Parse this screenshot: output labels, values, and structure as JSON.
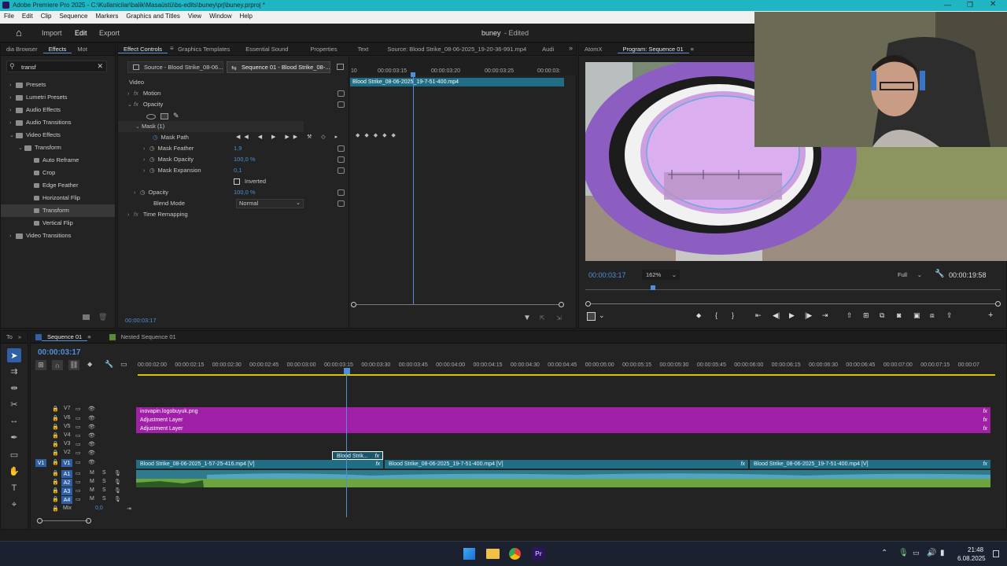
{
  "title_bar": {
    "text": "Adobe Premiere Pro 2025 - C:\\Kullanicilar\\balik\\Masaüstü\\bs-edits\\buney\\prj\\buney.prproj *"
  },
  "menu": [
    "File",
    "Edit",
    "Clip",
    "Sequence",
    "Markers",
    "Graphics and Titles",
    "View",
    "Window",
    "Help"
  ],
  "workspace": {
    "home_icon": "home-icon",
    "import": "Import",
    "edit": "Edit",
    "export": "Export",
    "project_name": "buney",
    "status": "- Edited"
  },
  "effects_panel": {
    "tabs": [
      "dia Browser",
      "Effects",
      "Mot"
    ],
    "search_value": "transf",
    "items": [
      {
        "label": "Presets",
        "level": 0
      },
      {
        "label": "Lumetri Presets",
        "level": 0
      },
      {
        "label": "Audio Effects",
        "level": 0
      },
      {
        "label": "Audio Transitions",
        "level": 0
      },
      {
        "label": "Video Effects",
        "level": 0
      },
      {
        "label": "Transform",
        "level": 1
      },
      {
        "label": "Auto Reframe",
        "level": 2
      },
      {
        "label": "Crop",
        "level": 2
      },
      {
        "label": "Edge Feather",
        "level": 2
      },
      {
        "label": "Horizontal Flip",
        "level": 2
      },
      {
        "label": "Transform",
        "level": 2
      },
      {
        "label": "Vertical Flip",
        "level": 2
      },
      {
        "label": "Video Transitions",
        "level": 0
      }
    ]
  },
  "effect_controls": {
    "tabs": [
      "Effect Controls",
      "Graphics Templates",
      "Essential Sound",
      "Properties",
      "Text",
      "Source: Blood Strike_08-06-2025_19-20-36-991.mp4",
      "Audi"
    ],
    "source_label": "Source - Blood Strike_08-06...",
    "sequence_label": "Sequence 01 - Blood Strike_08-...",
    "section": "Video",
    "motion": "Motion",
    "opacity": "Opacity",
    "mask": "Mask (1)",
    "mask_path": "Mask Path",
    "mask_feather": "Mask Feather",
    "mask_feather_val": "1,9",
    "mask_opacity": "Mask Opacity",
    "mask_opacity_val": "100,0 %",
    "mask_expansion": "Mask Expansion",
    "mask_expansion_val": "0,1",
    "inverted": "Inverted",
    "opacity2": "Opacity",
    "opacity2_val": "100,0 %",
    "blend_mode": "Blend Mode",
    "blend_mode_val": "Normal",
    "time_remapping": "Time Remapping",
    "timecode": "00:00:03:17",
    "mini_tl_ticks": [
      "10",
      "00:00:03:15",
      "00:00:03:20",
      "00:00:03:25",
      "00:00:03:"
    ],
    "mini_clip": "Blood Strike_08-06-2025_19-7-51-400.mp4"
  },
  "program_monitor": {
    "tabs": [
      "AtomX",
      "Program: Sequence 01"
    ],
    "timecode": "00:00:03:17",
    "zoom": "162%",
    "quality": "Full",
    "duration": "00:00:19:58"
  },
  "timeline": {
    "tabs_left": "To",
    "tab": "Sequence 01",
    "tab2": "Nested Sequence 01",
    "timecode": "00:00:03:17",
    "ruler": [
      "00:00:02:00",
      "00:00:02:15",
      "00:00:02:30",
      "00:00:02:45",
      "00:00:03:00",
      "00:00:03:15",
      "00:00:03:30",
      "00:00:03:45",
      "00:00:04:00",
      "00:00:04:15",
      "00:00:04:30",
      "00:00:04:45",
      "00:00:05:00",
      "00:00:05:15",
      "00:00:05:30",
      "00:00:05:45",
      "00:00:06:00",
      "00:00:06:15",
      "00:00:06:30",
      "00:00:06:45",
      "00:00:07:00",
      "00:00:07:15",
      "00:00:07"
    ],
    "video_tracks": [
      "V7",
      "V6",
      "V5",
      "V4",
      "V3",
      "V2",
      "V1"
    ],
    "audio_tracks": [
      "A1",
      "A2",
      "A3",
      "A4"
    ],
    "v1_source": "V1",
    "mix": "Mix",
    "mix_val": "0,0",
    "clips": {
      "v7": "inovapin.logobuyuk.png",
      "v6": "Adjustment Layer",
      "v5": "Adjustment Layer",
      "v2": "Blood Strik...",
      "v1a": "Blood Strike_08-06-2025_1-57-25-416.mp4 [V]",
      "v1b": "Blood Strike_08-06-2025_19-7-51-400.mp4 [V]",
      "v1c": "Blood Strike_08-06-2025_19-7-51-400.mp4 [V]",
      "fx": "fx",
      "m": "M",
      "s": "S"
    }
  },
  "taskbar": {
    "time": "21:48",
    "date": "6.08.2025"
  }
}
